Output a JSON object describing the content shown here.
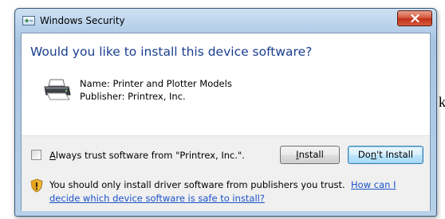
{
  "background": {
    "stray_char": "k"
  },
  "window": {
    "title": "Windows Security",
    "icons": {
      "app": "windows-security-icon",
      "close": "close-icon"
    }
  },
  "dialog": {
    "question": "Would you like to install this device software?",
    "device": {
      "icon": "printer-icon",
      "name": "Name: Printer and Plotter Models",
      "publisher": "Publisher: Printrex, Inc."
    },
    "checkbox": {
      "label_prefix": "A",
      "label_rest": "lways trust software from \"Printrex, Inc.\".",
      "checked": false
    },
    "buttons": {
      "install": {
        "mnemonic": "I",
        "rest": "nstall"
      },
      "dont_install": {
        "prefix": "Do",
        "mnemonic": "n",
        "rest": "'t Install"
      }
    },
    "warning": {
      "icon": "shield-warning-icon",
      "text": "You should only install driver software from publishers you trust.",
      "link_part1": "How can I",
      "link_part2": "decide which device software is safe to install?"
    }
  },
  "colors": {
    "question_text": "#1a3e8f",
    "link": "#1a52c7",
    "close_button": "#c9432a",
    "titlebar": "#b7d0ea"
  }
}
